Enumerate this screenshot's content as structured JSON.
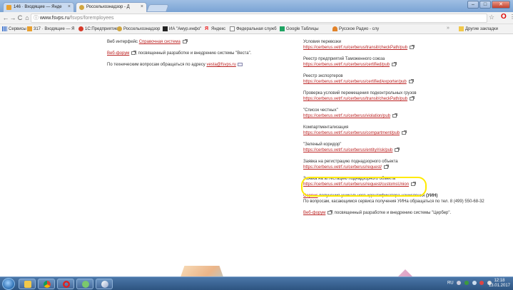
{
  "browser": {
    "tabs": [
      {
        "title": "146 · Входящие — Янде",
        "active": false
      },
      {
        "title": "Россельхознадзор - Д",
        "active": true
      }
    ],
    "window_buttons": {
      "minimize": "–",
      "maximize": "□",
      "close": "✕"
    },
    "nav": {
      "back": "←",
      "forward": "→",
      "reload": "C",
      "home": "⌂"
    },
    "address": {
      "host": "www.fsvps.ru",
      "path": "/fsvps/foremployees"
    },
    "bookmarks": [
      {
        "label": "Сервисы",
        "icon": "apps-icon"
      },
      {
        "label": "317 · Входящие — Я",
        "icon": "mail-icon"
      },
      {
        "label": "1С:Предприятие",
        "icon": "arrow-icon"
      },
      {
        "label": "Россельхознадзор",
        "icon": "emblem-icon"
      },
      {
        "label": "ИА \"Амур.инфо\"",
        "icon": "news-icon"
      },
      {
        "label": "Яндекс",
        "icon": "yandex-icon"
      },
      {
        "label": "Федеральная служб",
        "icon": "page-icon"
      },
      {
        "label": "Google Таблицы",
        "icon": "sheets-icon"
      },
      {
        "label": "Русское Радио - слу",
        "icon": "radio-icon"
      }
    ],
    "bookmarks_more": "»",
    "other_bookmarks": "Другие закладки"
  },
  "page": {
    "left": {
      "web_interface_prefix": "Веб интерфейс",
      "web_interface_link": "Справочная система",
      "forum_link": "Веб-форум",
      "forum_text": ", посвященный разработке и внедрению системы \"Веста\".",
      "tech_prefix": "По техническим вопросам обращаться по адресу",
      "tech_email": "vesta@fsvps.ru"
    },
    "right": {
      "items": [
        {
          "title": "Условия перевозки",
          "url": "https://cerberus.vetrf.ru/cerberus/transit/checkPath/pub"
        },
        {
          "title": "Реестр предприятий Таможенного союза",
          "url": "https://cerberus.vetrf.ru/cerberus/certified/pub"
        },
        {
          "title": "Реестр экспортеров",
          "url": "https://cerberus.vetrf.ru/cerberus/certified/exporter/pub"
        },
        {
          "title": "Проверка условий перемещения подконтрольных грузов",
          "url": "https://cerberus.vetrf.ru/cerberus/transit/checkPath/pub"
        },
        {
          "title": "\"Список честных\"",
          "url": "https://cerberus.vetrf.ru/cerberus/violation/pub"
        },
        {
          "title": "Компартментализация",
          "url": "https://cerberus.vetrf.ru/cerberus/compartment/pub"
        },
        {
          "title": "\"Зеленый коридор\"",
          "url": "https://cerberus.vetrf.ru/cerberus/entity/risk/pub"
        },
        {
          "title": "Заявка на регистрацию поднадзорного объекта",
          "url": "https://cerberus.vetrf.ru/cerberus/request/"
        },
        {
          "title": "Заявка на аттестацию поднадзорного объекта",
          "url": "https://cerberus.vetrf.ru/cerberus/request/customsUnion"
        }
      ],
      "uin_link": "Сервис",
      "uin_text_a": "получения уникального идентификатора начисления",
      "uin_bold": "(УИН)",
      "uin_phone_text": "По вопросам, касающимся сервиса получения УИНа обращаться по тел. 8 (499) 550-68-32",
      "forum_link": "Веб-форум",
      "forum_text": ", посвященный разработке и внедрению системы \"Цербер\"."
    }
  },
  "taskbar": {
    "tray_lang": "RU",
    "clock_time": "12:18",
    "clock_date": "13.01.2017"
  },
  "colors": {
    "link": "#bb2222",
    "highlight": "#ffea00",
    "taskbar": "#2d5480"
  }
}
